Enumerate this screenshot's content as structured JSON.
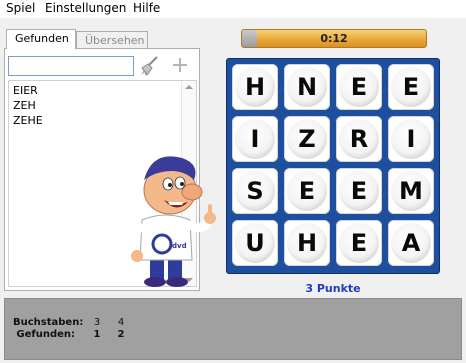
{
  "menu": [
    "Spiel",
    "Einstellungen",
    "Hilfe"
  ],
  "tabs": {
    "found": "Gefunden",
    "missed": "Übersehen"
  },
  "search": {
    "value": "",
    "placeholder": ""
  },
  "found_words": [
    "EIER",
    "ZEH",
    "ZEHE"
  ],
  "timer": {
    "text": "0:12",
    "elapsed_fraction": 0.08
  },
  "board": [
    [
      "H",
      "N",
      "E",
      "E"
    ],
    [
      "I",
      "Z",
      "R",
      "I"
    ],
    [
      "S",
      "E",
      "E",
      "M"
    ],
    [
      "U",
      "H",
      "E",
      "A"
    ]
  ],
  "score": "3 Punkte",
  "stats": {
    "letters_label": "Buchstaben:",
    "found_label": "Gefunden:",
    "letters": [
      "3",
      "4"
    ],
    "found": [
      "1",
      "2"
    ]
  },
  "mascot": {
    "shirt_text": "dvd"
  },
  "colors": {
    "board": "#1e4f9e",
    "score": "#1a3cc8",
    "timer": "#e8a93a"
  }
}
